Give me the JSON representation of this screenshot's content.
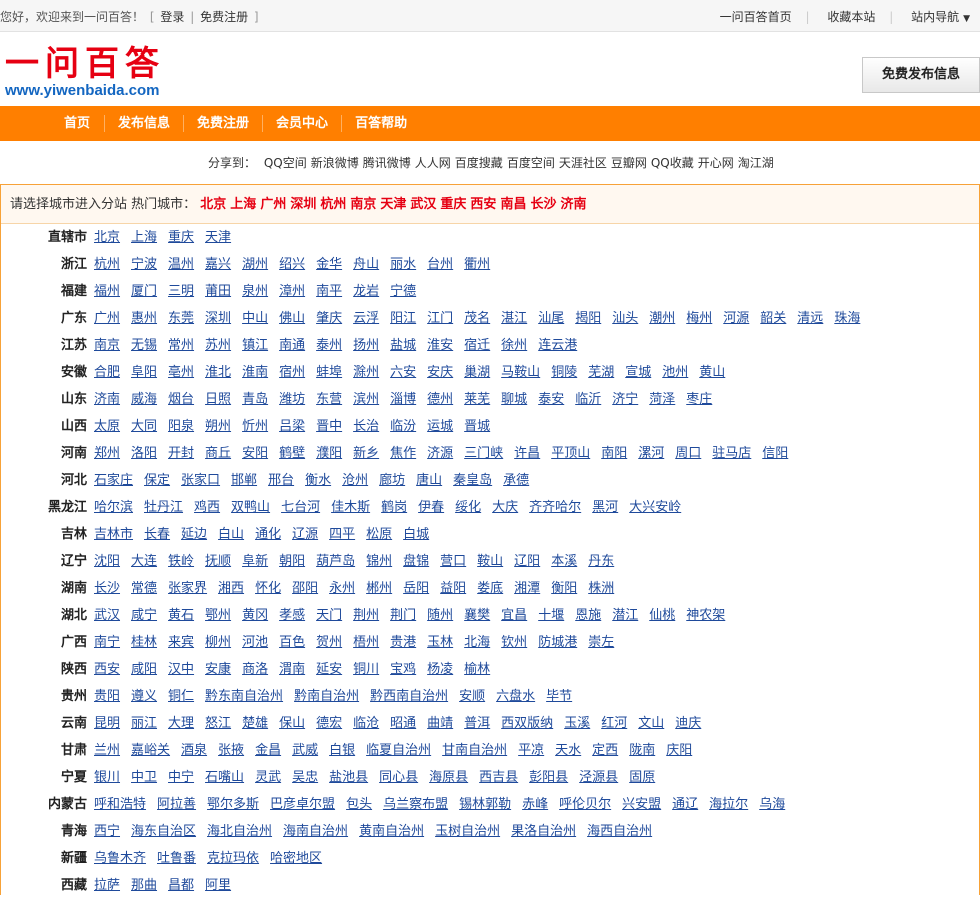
{
  "topbar": {
    "welcome": "您好，欢迎来到一问百答！",
    "bracket_open": "[",
    "login": "登录",
    "divider": "|",
    "register": "免费注册",
    "bracket_close": "]",
    "home": "一问百答首页",
    "bookmark": "收藏本站",
    "site_nav": "站内导航",
    "site_nav_caret": "▼"
  },
  "logo": {
    "cn": "一问百答",
    "url": "www.yiwenbaida.com"
  },
  "publish_button": "免费发布信息",
  "nav": [
    "首页",
    "发布信息",
    "免费注册",
    "会员中心",
    "百答帮助"
  ],
  "share": {
    "label": "分享到：",
    "items": [
      "QQ空间",
      "新浪微博",
      "腾讯微博",
      "人人网",
      "百度搜藏",
      "百度空间",
      "天涯社区",
      "豆瓣网",
      "QQ收藏",
      "开心网",
      "淘江湖"
    ]
  },
  "hot": {
    "label": "请选择城市进入分站 热门城市：",
    "cities": [
      "北京",
      "上海",
      "广州",
      "深圳",
      "杭州",
      "南京",
      "天津",
      "武汉",
      "重庆",
      "西安",
      "南昌",
      "长沙",
      "济南"
    ]
  },
  "provinces": [
    {
      "name": "直辖市",
      "cities": [
        "北京",
        "上海",
        "重庆",
        "天津"
      ]
    },
    {
      "name": "浙江",
      "cities": [
        "杭州",
        "宁波",
        "温州",
        "嘉兴",
        "湖州",
        "绍兴",
        "金华",
        "舟山",
        "丽水",
        "台州",
        "衢州"
      ]
    },
    {
      "name": "福建",
      "cities": [
        "福州",
        "厦门",
        "三明",
        "莆田",
        "泉州",
        "漳州",
        "南平",
        "龙岩",
        "宁德"
      ]
    },
    {
      "name": "广东",
      "cities": [
        "广州",
        "惠州",
        "东莞",
        "深圳",
        "中山",
        "佛山",
        "肇庆",
        "云浮",
        "阳江",
        "江门",
        "茂名",
        "湛江",
        "汕尾",
        "揭阳",
        "汕头",
        "潮州",
        "梅州",
        "河源",
        "韶关",
        "清远",
        "珠海"
      ]
    },
    {
      "name": "江苏",
      "cities": [
        "南京",
        "无锡",
        "常州",
        "苏州",
        "镇江",
        "南通",
        "泰州",
        "扬州",
        "盐城",
        "淮安",
        "宿迁",
        "徐州",
        "连云港"
      ]
    },
    {
      "name": "安徽",
      "cities": [
        "合肥",
        "阜阳",
        "亳州",
        "淮北",
        "淮南",
        "宿州",
        "蚌埠",
        "滁州",
        "六安",
        "安庆",
        "巢湖",
        "马鞍山",
        "铜陵",
        "芜湖",
        "宣城",
        "池州",
        "黄山"
      ]
    },
    {
      "name": "山东",
      "cities": [
        "济南",
        "威海",
        "烟台",
        "日照",
        "青岛",
        "潍坊",
        "东营",
        "滨州",
        "淄博",
        "德州",
        "莱芜",
        "聊城",
        "泰安",
        "临沂",
        "济宁",
        "菏泽",
        "枣庄"
      ]
    },
    {
      "name": "山西",
      "cities": [
        "太原",
        "大同",
        "阳泉",
        "朔州",
        "忻州",
        "吕梁",
        "晋中",
        "长治",
        "临汾",
        "运城",
        "晋城"
      ]
    },
    {
      "name": "河南",
      "cities": [
        "郑州",
        "洛阳",
        "开封",
        "商丘",
        "安阳",
        "鹤壁",
        "濮阳",
        "新乡",
        "焦作",
        "济源",
        "三门峡",
        "许昌",
        "平顶山",
        "南阳",
        "漯河",
        "周口",
        "驻马店",
        "信阳"
      ]
    },
    {
      "name": "河北",
      "cities": [
        "石家庄",
        "保定",
        "张家口",
        "邯郸",
        "邢台",
        "衡水",
        "沧州",
        "廊坊",
        "唐山",
        "秦皇岛",
        "承德"
      ]
    },
    {
      "name": "黑龙江",
      "cities": [
        "哈尔滨",
        "牡丹江",
        "鸡西",
        "双鸭山",
        "七台河",
        "佳木斯",
        "鹤岗",
        "伊春",
        "绥化",
        "大庆",
        "齐齐哈尔",
        "黑河",
        "大兴安岭"
      ]
    },
    {
      "name": "吉林",
      "cities": [
        "吉林市",
        "长春",
        "延边",
        "白山",
        "通化",
        "辽源",
        "四平",
        "松原",
        "白城"
      ]
    },
    {
      "name": "辽宁",
      "cities": [
        "沈阳",
        "大连",
        "铁岭",
        "抚顺",
        "阜新",
        "朝阳",
        "葫芦岛",
        "锦州",
        "盘锦",
        "营口",
        "鞍山",
        "辽阳",
        "本溪",
        "丹东"
      ]
    },
    {
      "name": "湖南",
      "cities": [
        "长沙",
        "常德",
        "张家界",
        "湘西",
        "怀化",
        "邵阳",
        "永州",
        "郴州",
        "岳阳",
        "益阳",
        "娄底",
        "湘潭",
        "衡阳",
        "株洲"
      ]
    },
    {
      "name": "湖北",
      "cities": [
        "武汉",
        "咸宁",
        "黄石",
        "鄂州",
        "黄冈",
        "孝感",
        "天门",
        "荆州",
        "荆门",
        "随州",
        "襄樊",
        "宜昌",
        "十堰",
        "恩施",
        "潜江",
        "仙桃",
        "神农架"
      ]
    },
    {
      "name": "广西",
      "cities": [
        "南宁",
        "桂林",
        "来宾",
        "柳州",
        "河池",
        "百色",
        "贺州",
        "梧州",
        "贵港",
        "玉林",
        "北海",
        "钦州",
        "防城港",
        "崇左"
      ]
    },
    {
      "name": "陕西",
      "cities": [
        "西安",
        "咸阳",
        "汉中",
        "安康",
        "商洛",
        "渭南",
        "延安",
        "铜川",
        "宝鸡",
        "杨凌",
        "榆林"
      ]
    },
    {
      "name": "贵州",
      "cities": [
        "贵阳",
        "遵义",
        "铜仁",
        "黔东南自治州",
        "黔南自治州",
        "黔西南自治州",
        "安顺",
        "六盘水",
        "毕节"
      ]
    },
    {
      "name": "云南",
      "cities": [
        "昆明",
        "丽江",
        "大理",
        "怒江",
        "楚雄",
        "保山",
        "德宏",
        "临沧",
        "昭通",
        "曲靖",
        "普洱",
        "西双版纳",
        "玉溪",
        "红河",
        "文山",
        "迪庆"
      ]
    },
    {
      "name": "甘肃",
      "cities": [
        "兰州",
        "嘉峪关",
        "酒泉",
        "张掖",
        "金昌",
        "武威",
        "白银",
        "临夏自治州",
        "甘南自治州",
        "平凉",
        "天水",
        "定西",
        "陇南",
        "庆阳"
      ]
    },
    {
      "name": "宁夏",
      "cities": [
        "银川",
        "中卫",
        "中宁",
        "石嘴山",
        "灵武",
        "吴忠",
        "盐池县",
        "同心县",
        "海原县",
        "西吉县",
        "彭阳县",
        "泾源县",
        "固原"
      ]
    },
    {
      "name": "内蒙古",
      "cities": [
        "呼和浩特",
        "阿拉善",
        "鄂尔多斯",
        "巴彦卓尔盟",
        "包头",
        "乌兰察布盟",
        "锡林郭勒",
        "赤峰",
        "呼伦贝尔",
        "兴安盟",
        "通辽",
        "海拉尔",
        "乌海"
      ]
    },
    {
      "name": "青海",
      "cities": [
        "西宁",
        "海东自治区",
        "海北自治州",
        "海南自治州",
        "黄南自治州",
        "玉树自治州",
        "果洛自治州",
        "海西自治州"
      ]
    },
    {
      "name": "新疆",
      "cities": [
        "乌鲁木齐",
        "吐鲁番",
        "克拉玛依",
        "哈密地区"
      ]
    },
    {
      "name": "西藏",
      "cities": [
        "拉萨",
        "那曲",
        "昌都",
        "阿里"
      ]
    }
  ],
  "colors": {
    "nav_bg": "#ff7f00",
    "logo_red": "#e60012",
    "logo_blue": "#1366c1",
    "link_blue": "#1f4a9b",
    "hot_red": "#e60012"
  }
}
